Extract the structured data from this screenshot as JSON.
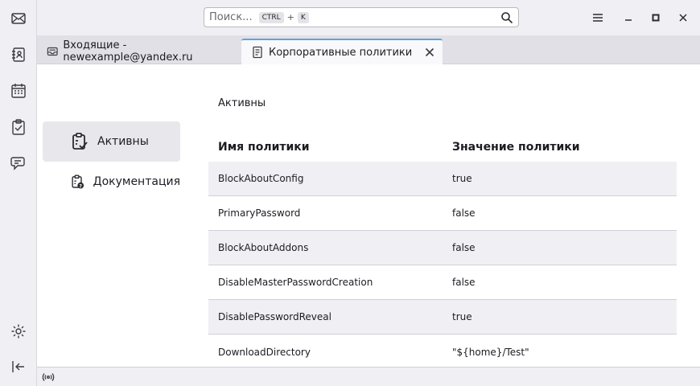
{
  "search": {
    "placeholder": "Поиск...",
    "kbd1": "CTRL",
    "plus": "+",
    "kbd2": "K"
  },
  "tabs": [
    {
      "label": "Входящие - newexample@yandex.ru"
    },
    {
      "label": "Корпоративные политики"
    }
  ],
  "sidebar": {
    "items": [
      {
        "label": "Активны"
      },
      {
        "label": "Документация"
      }
    ]
  },
  "main": {
    "heading": "Активны",
    "columns": [
      "Имя политики",
      "Значение политики"
    ],
    "rows": [
      {
        "name": "BlockAboutConfig",
        "value": "true"
      },
      {
        "name": "PrimaryPassword",
        "value": "false"
      },
      {
        "name": "BlockAboutAddons",
        "value": "false"
      },
      {
        "name": "DisableMasterPasswordCreation",
        "value": "false"
      },
      {
        "name": "DisablePasswordReveal",
        "value": "true"
      },
      {
        "name": "DownloadDirectory",
        "value": "\"${home}/Test\""
      }
    ]
  },
  "colors": {
    "accent": "#5ea4de",
    "row_alt": "#f0f0f4",
    "active_category": "#e8e8ec"
  }
}
